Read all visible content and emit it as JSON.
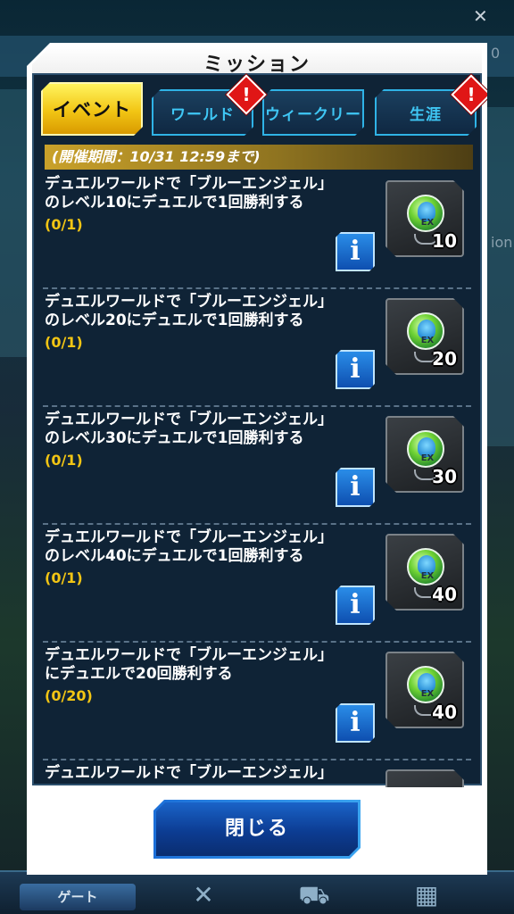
{
  "background": {
    "right_label": "ion",
    "corner_label": "0",
    "bottom_nav": {
      "gate_label": "ゲート"
    }
  },
  "dialog": {
    "title": "ミッション",
    "tabs": [
      {
        "label": "イベント",
        "active": true,
        "alert": false
      },
      {
        "label": "ワールド",
        "active": false,
        "alert": true,
        "alert_symbol": "!"
      },
      {
        "label": "ウィークリー",
        "active": false,
        "alert": false
      },
      {
        "label": "生涯",
        "active": false,
        "alert": true,
        "alert_symbol": "!"
      }
    ],
    "period": "(開催期間：10/31 12:59まで)",
    "missions": [
      {
        "line1": "デュエルワールドで「ブルーエンジェル」",
        "line2": "のレベル10にデュエルで1回勝利する",
        "progress": "(0/1)",
        "reward_count": "10",
        "reward_label": "EX",
        "info": "i"
      },
      {
        "line1": "デュエルワールドで「ブルーエンジェル」",
        "line2": "のレベル20にデュエルで1回勝利する",
        "progress": "(0/1)",
        "reward_count": "20",
        "reward_label": "EX",
        "info": "i"
      },
      {
        "line1": "デュエルワールドで「ブルーエンジェル」",
        "line2": "のレベル30にデュエルで1回勝利する",
        "progress": "(0/1)",
        "reward_count": "30",
        "reward_label": "EX",
        "info": "i"
      },
      {
        "line1": "デュエルワールドで「ブルーエンジェル」",
        "line2": "のレベル40にデュエルで1回勝利する",
        "progress": "(0/1)",
        "reward_count": "40",
        "reward_label": "EX",
        "info": "i"
      },
      {
        "line1": "デュエルワールドで「ブルーエンジェル」",
        "line2": "にデュエルで20回勝利する",
        "progress": "(0/20)",
        "reward_count": "40",
        "reward_label": "EX",
        "info": "i"
      },
      {
        "line1": "デュエルワールドで「ブルーエンジェル」",
        "line2": "",
        "progress": "",
        "reward_count": "",
        "reward_label": "",
        "info": ""
      }
    ],
    "close_label": "閉じる"
  },
  "colors": {
    "active_tab": "#f2c514",
    "tab_text": "#3fc7f5",
    "progress_text": "#f2c514",
    "alert_badge": "#e01616",
    "panel_bg": "#0f2336"
  }
}
